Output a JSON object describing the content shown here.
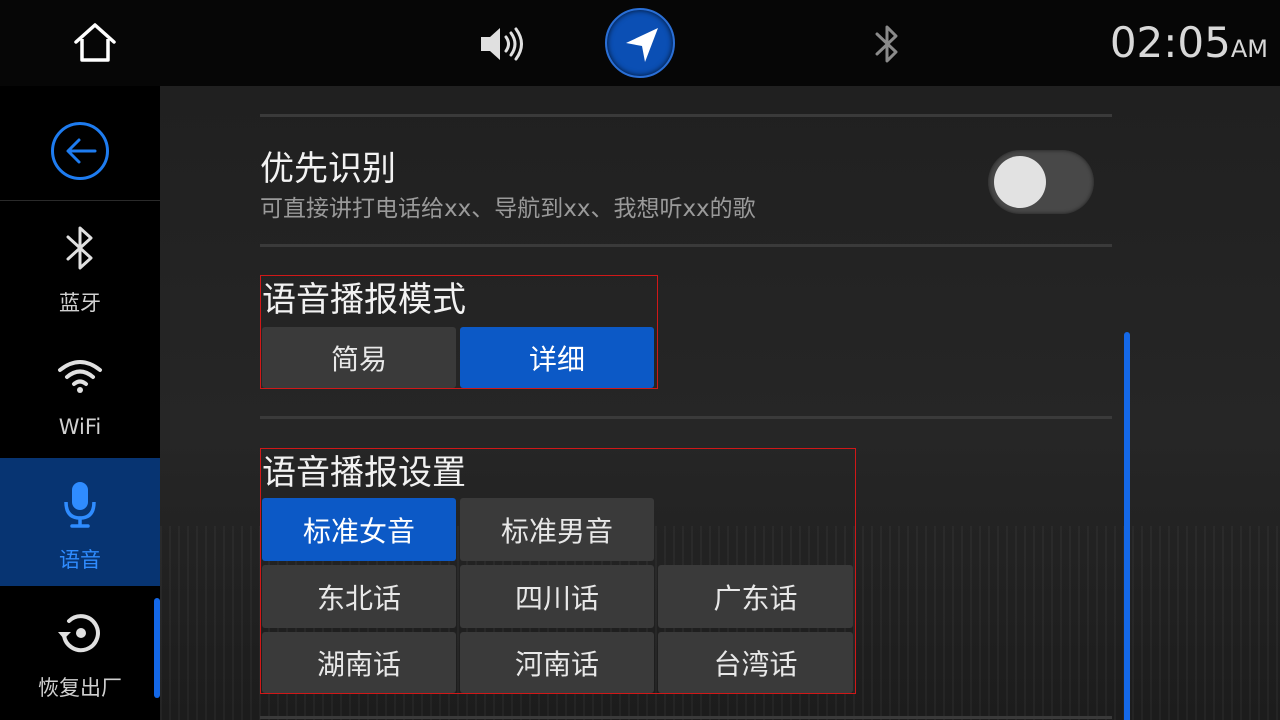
{
  "topbar": {
    "home_icon": "home-icon",
    "volume_icon": "volume-icon",
    "navigation_icon": "navigation-arrow-icon",
    "bluetooth_icon": "bluetooth-icon",
    "clock_time": "02:05",
    "clock_ampm": "AM"
  },
  "sidebar": {
    "back_icon": "back-arrow-icon",
    "items": [
      {
        "label": "蓝牙",
        "icon": "bluetooth-icon",
        "active": false
      },
      {
        "label": "WiFi",
        "icon": "wifi-icon",
        "active": false
      },
      {
        "label": "语音",
        "icon": "microphone-icon",
        "active": true
      },
      {
        "label": "恢复出厂",
        "icon": "factory-reset-icon",
        "active": false
      }
    ]
  },
  "settings": {
    "priority_recognition": {
      "title": "优先识别",
      "subtitle": "可直接讲打电话给xx、导航到xx、我想听xx的歌",
      "enabled": false
    },
    "broadcast_mode": {
      "title": "语音播报模式",
      "options": [
        "简易",
        "详细"
      ],
      "selected": "详细"
    },
    "broadcast_voice": {
      "title": "语音播报设置",
      "options": [
        "标准女音",
        "标准男音",
        "东北话",
        "四川话",
        "广东话",
        "湖南话",
        "河南话",
        "台湾话"
      ],
      "selected": "标准女音"
    }
  },
  "colors": {
    "accent": "#0c59c6",
    "active_text": "#2f8cff",
    "outline": "#d01818"
  }
}
